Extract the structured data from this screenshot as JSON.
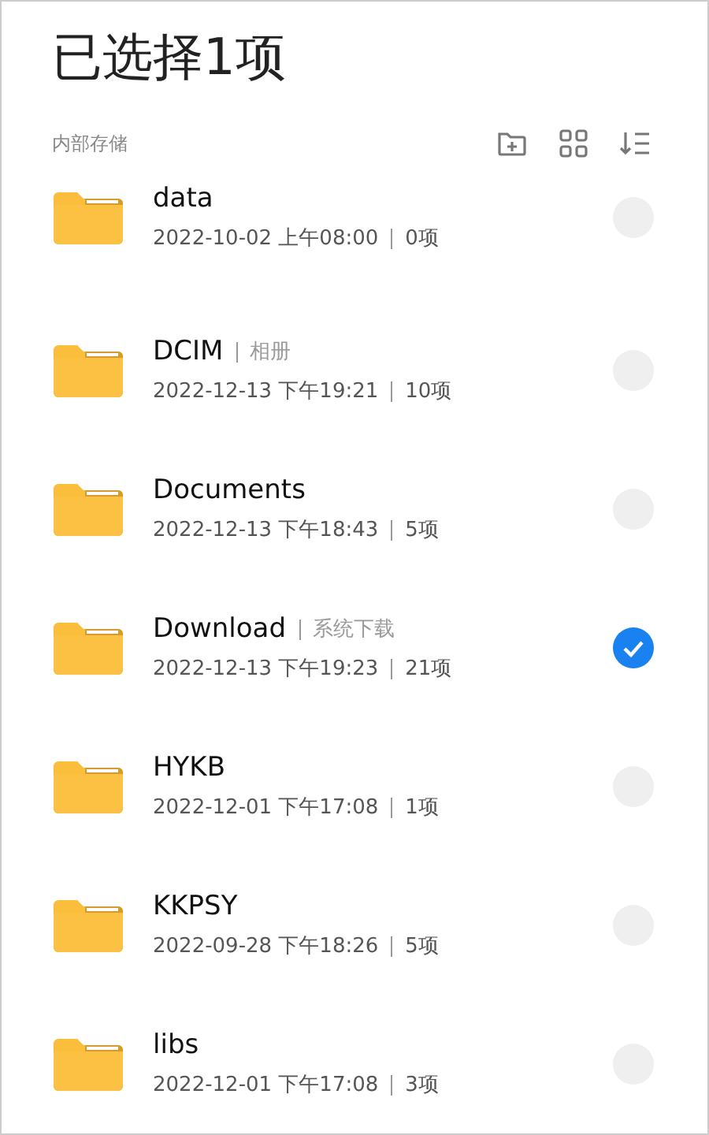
{
  "title": "已选择1项",
  "section": {
    "label": "内部存储"
  },
  "folders": [
    {
      "name": "data",
      "date": "2022-10-02 上午08:00",
      "count": "0项",
      "selected": false
    },
    {
      "name": "DCIM",
      "tag": "相册",
      "date": "2022-12-13 下午19:21",
      "count": "10项",
      "selected": false
    },
    {
      "name": "Documents",
      "date": "2022-12-13 下午18:43",
      "count": "5项",
      "selected": false
    },
    {
      "name": "Download",
      "tag": "系统下载",
      "date": "2022-12-13 下午19:23",
      "count": "21项",
      "selected": true
    },
    {
      "name": "HYKB",
      "date": "2022-12-01 下午17:08",
      "count": "1项",
      "selected": false
    },
    {
      "name": "KKPSY",
      "date": "2022-09-28 下午18:26",
      "count": "5项",
      "selected": false
    },
    {
      "name": "libs",
      "date": "2022-12-01 下午17:08",
      "count": "3项",
      "selected": false
    }
  ]
}
